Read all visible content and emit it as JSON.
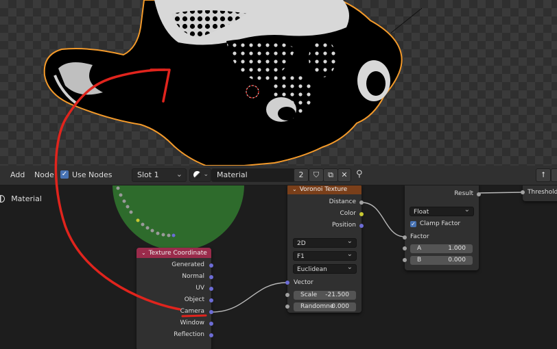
{
  "header": {
    "add_label": "Add",
    "node_label": "Node",
    "use_nodes_label": "Use Nodes",
    "use_nodes_checked": true,
    "slot_label": "Slot 1",
    "material_name": "Material",
    "user_count": "2"
  },
  "sidebar": {
    "material_label": "Material"
  },
  "nodes": {
    "texcoord": {
      "title": "Texture Coordinate",
      "outputs": [
        "Generated",
        "Normal",
        "UV",
        "Object",
        "Camera",
        "Window",
        "Reflection"
      ]
    },
    "voronoi": {
      "title": "Voronoi Texture",
      "outputs": [
        "Distance",
        "Color",
        "Position"
      ],
      "dim": "2D",
      "feature": "F1",
      "metric": "Euclidean",
      "vector_label": "Vector",
      "scale_label": "Scale",
      "scale_value": "-21.500",
      "random_label": "Randomne",
      "random_value": "0.000"
    },
    "math": {
      "result_label": "Result",
      "type": "Float",
      "clamp_label": "Clamp Factor",
      "clamp_checked": true,
      "factor_label": "Factor",
      "a_label": "A",
      "a_value": "1.000",
      "b_label": "B",
      "b_value": "0.000"
    },
    "threshold": {
      "label": "Threshold"
    }
  },
  "colors": {
    "annotation": "#e0241d",
    "outline": "#f49a2a",
    "texcoord_header": "#9a2b4b",
    "voronoi_header": "#7a3f1a",
    "socket_blue": "#6c6cd6",
    "socket_yellow": "#c8c832",
    "socket_gray": "#a1a1a1"
  }
}
